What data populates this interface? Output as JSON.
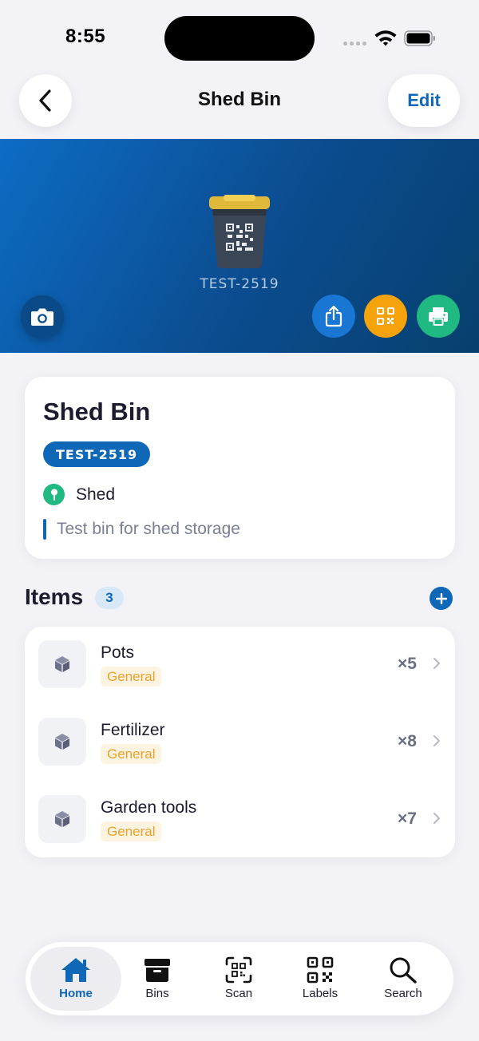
{
  "status_bar": {
    "time": "8:55"
  },
  "nav": {
    "title": "Shed Bin",
    "edit_label": "Edit"
  },
  "hero": {
    "bin_code": "TEST-2519"
  },
  "bin": {
    "name": "Shed Bin",
    "code": "TEST-2519",
    "location": "Shed",
    "description": "Test bin for shed storage"
  },
  "items_section": {
    "title": "Items",
    "count": "3"
  },
  "items": [
    {
      "name": "Pots",
      "category": "General",
      "quantity": "×5"
    },
    {
      "name": "Fertilizer",
      "category": "General",
      "quantity": "×8"
    },
    {
      "name": "Garden tools",
      "category": "General",
      "quantity": "×7"
    }
  ],
  "tabs": [
    {
      "label": "Home",
      "icon": "house-icon",
      "active": true
    },
    {
      "label": "Bins",
      "icon": "archive-box-icon",
      "active": false
    },
    {
      "label": "Scan",
      "icon": "qr-scan-icon",
      "active": false
    },
    {
      "label": "Labels",
      "icon": "qr-code-icon",
      "active": false
    },
    {
      "label": "Search",
      "icon": "magnifier-icon",
      "active": false
    }
  ],
  "colors": {
    "accent": "#0f67b8",
    "hero_start": "#0d6cc4",
    "hero_end": "#07406e",
    "qr_button": "#f6a20b",
    "print_button": "#1fb981",
    "location_icon": "#1fb981",
    "category_tag_text": "#eba22c"
  }
}
